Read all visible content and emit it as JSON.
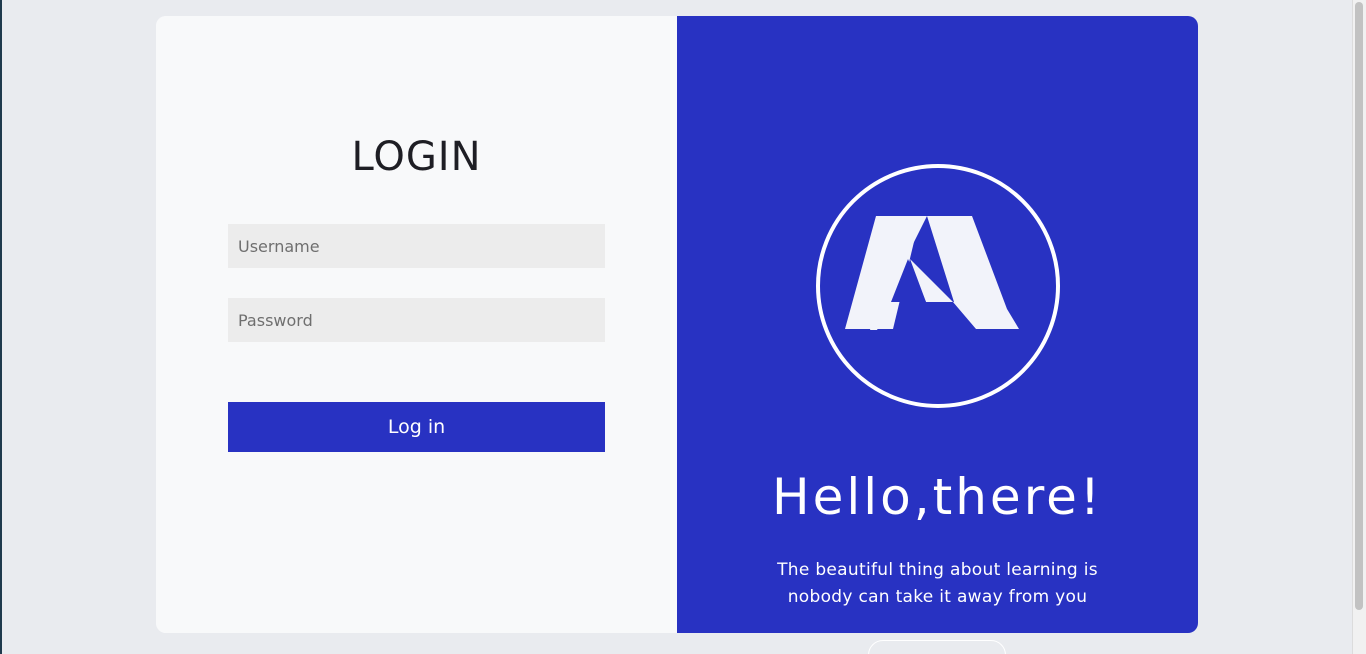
{
  "login": {
    "title": "LOGIN",
    "username_placeholder": "Username",
    "password_placeholder": "Password",
    "submit_label": "Log in"
  },
  "welcome": {
    "logo_icon": "brand-logo-icon",
    "greeting": "Hello,there!",
    "tagline_line1": "The beautiful thing about learning is",
    "tagline_line2": "nobody can take it away from you"
  },
  "colors": {
    "accent": "#2832c2",
    "panel_light": "#f8f9fa",
    "page_background": "#e9ebef",
    "input_background": "#ececec",
    "text_dark": "#1e1e24"
  }
}
